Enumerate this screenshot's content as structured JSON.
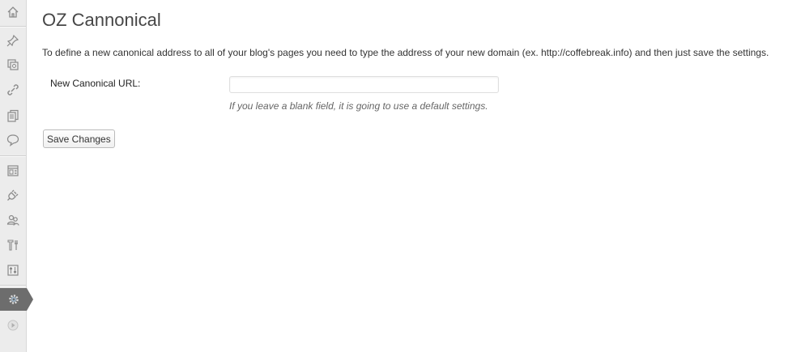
{
  "page": {
    "title": "OZ Cannonical",
    "intro": "To define a new canonical address to all of your blog's pages you need to type the address of your new domain (ex. http://coffebreak.info) and then just save the settings."
  },
  "form": {
    "canonical_url": {
      "label": "New Canonical URL:",
      "value": "",
      "placeholder": "",
      "description": "If you leave a blank field, it is going to use a default settings."
    },
    "save_label": "Save Changes"
  },
  "sidebar": {
    "items": [
      {
        "icon": "dashboard-icon"
      },
      {
        "icon": "posts-pin-icon"
      },
      {
        "icon": "media-icon"
      },
      {
        "icon": "links-icon"
      },
      {
        "icon": "pages-icon"
      },
      {
        "icon": "comments-icon"
      },
      {
        "icon": "appearance-icon"
      },
      {
        "icon": "plugins-icon"
      },
      {
        "icon": "users-icon"
      },
      {
        "icon": "tools-icon"
      },
      {
        "icon": "settings-sliders-icon"
      },
      {
        "icon": "gear-icon",
        "active": true
      },
      {
        "icon": "collapse-menu-icon"
      }
    ],
    "active_color": "#6d6d6d"
  }
}
